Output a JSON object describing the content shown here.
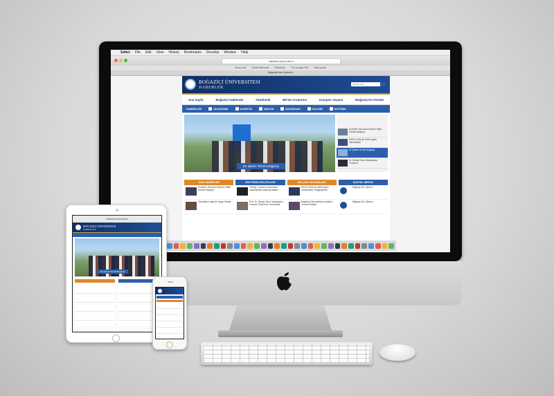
{
  "menubar": {
    "apple": "",
    "items": [
      "Safari",
      "File",
      "Edit",
      "View",
      "History",
      "Bookmarks",
      "Develop",
      "Window",
      "Help"
    ]
  },
  "browser": {
    "url": "haberler.boun.edu.tr",
    "bookmarks": [
      "Boun Lobi",
      "Social Networks",
      "Facebook",
      "The Lounge Site",
      "Data portal"
    ],
    "tab_title": "Boğaziçi'nden Haberler"
  },
  "site": {
    "title": "BOĞAZİÇİ ÜNİVERSİTESİ",
    "subtitle": "HABERLER",
    "search_placeholder": "Sitede ara",
    "nav": [
      "Ana Sayfa",
      "Boğaziçi Hakkında",
      "Akademik",
      "BÜ'de Araştırma",
      "Kampüs Yaşamı",
      "Boğaziçi'ne Destek"
    ],
    "subnav": [
      "HABERLER",
      "AKADEMİK",
      "KAMPÜS",
      "MEZUN",
      "BASINDAN",
      "GALERİ",
      "İLETİŞİM"
    ],
    "hero_caption": "En İyilerin Tercihi Boğaziçi",
    "side_items": [
      "Kordil'de \"Ekonomi Üzerine Talks\" Dönemi Başlıyor",
      "2015 LYS'de ilk 1000'e giren üniversiteler",
      "En İyilerin Tercihi Boğaziçi",
      "Dr. Şermin Öner Uluslararası Forumda"
    ],
    "sections": [
      {
        "title": "SON HABERLER",
        "color": "#e0872a",
        "rows": [
          "Kordil'de \"Ekonomi Üzerine Talks\" Dönemi Başlıyor",
          "Yenivadiy Lodge'da Tango Tatlıları"
        ]
      },
      {
        "title": "EDİTÖRÜN SEÇTİKLERİ",
        "color": "#2b5fae",
        "rows": [
          "Türkiye, Fransa ve Amerikan üniversiteleri arasında ilişkiler",
          "Prof. Dr. Şermin Öner Uluslararası Fenerler Ödülü'nün Yeni Sahibi"
        ]
      },
      {
        "title": "EN ÇOK OKUNANLAR",
        "color": "#e0872a",
        "rows": [
          "2015 LYS'de ilk 1000'e giren \"üniversiteler\" Boğaziçi'nde",
          "Boğaziçi Üniversitesi'nin girişimi \"Lezzet Rotaları\""
        ]
      },
      {
        "title": "SOSYAL MEDYA",
        "color": "#2b5fae",
        "rows": [
          "Boğaziçi Üni. @boun",
          "Boğaziçi Üni. @boun"
        ]
      }
    ]
  },
  "devices": {
    "ipad_url": "haberler.boun.edu.tr",
    "dock_count": 34
  },
  "colors": {
    "brand": "#1f4d94",
    "accent": "#2b5fae",
    "orange": "#e0872a"
  }
}
